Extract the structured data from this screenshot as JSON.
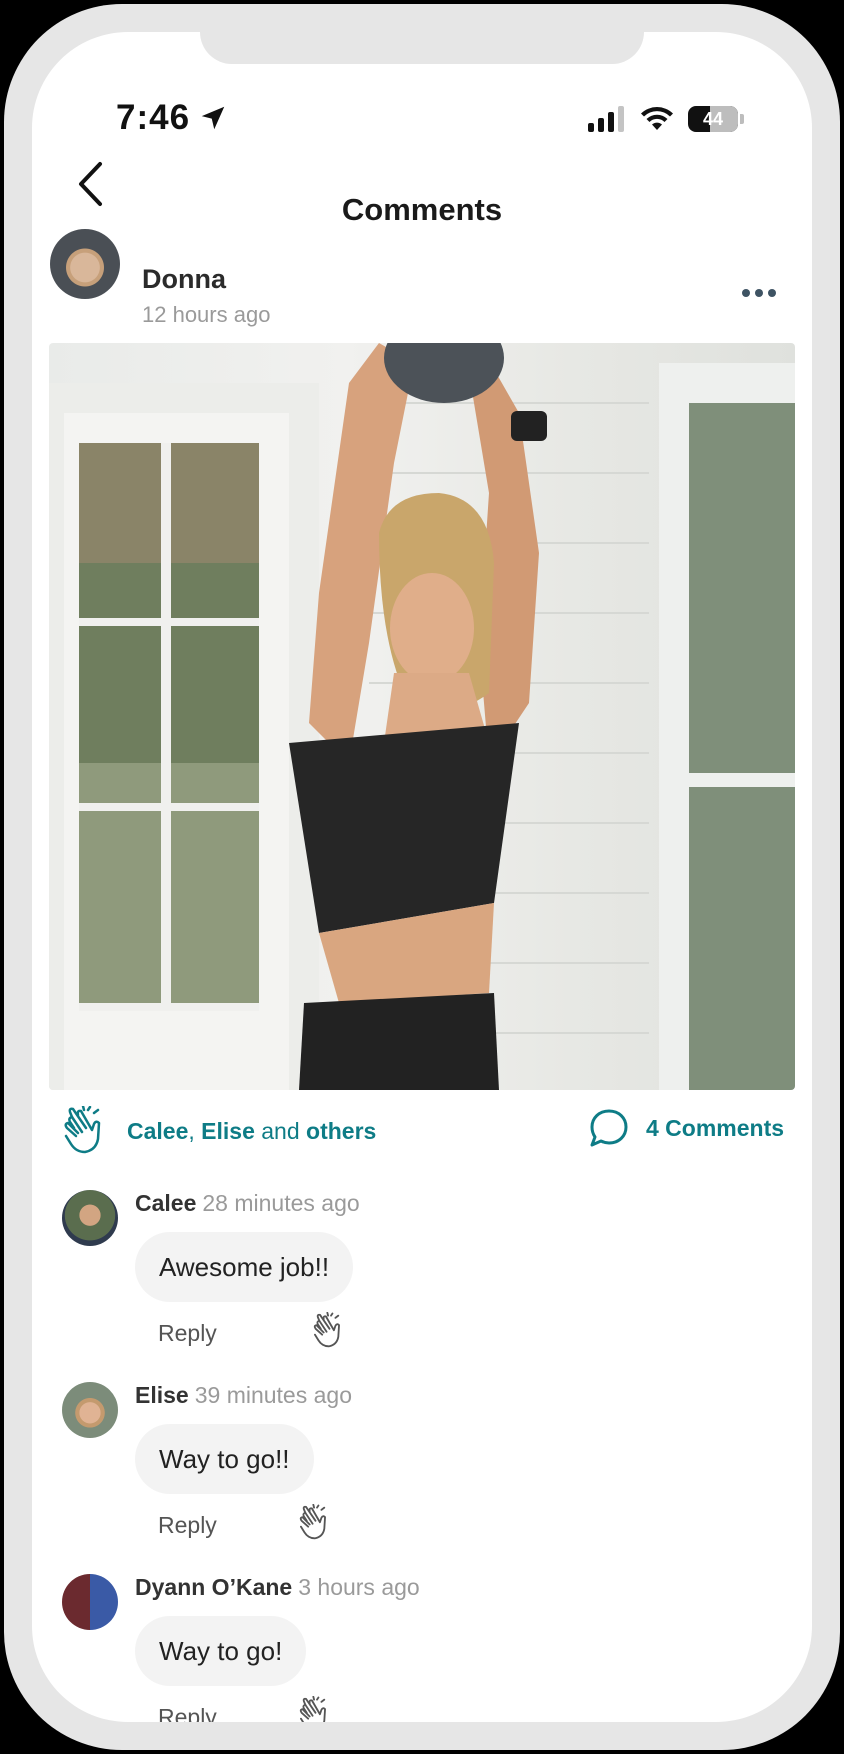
{
  "status": {
    "time": "7:46",
    "battery": "44"
  },
  "header": {
    "title": "Comments"
  },
  "post": {
    "author": "Donna",
    "time": "12 hours ago",
    "likers": {
      "name1": "Calee",
      "sep": ",",
      "name2": "Elise",
      "and": "and",
      "others": "others"
    },
    "comments_label": "4 Comments"
  },
  "comments": [
    {
      "name": "Calee",
      "time": "28 minutes ago",
      "text": "Awesome job!!",
      "reply": "Reply"
    },
    {
      "name": "Elise",
      "time": "39 minutes ago",
      "text": "Way to go!!",
      "reply": "Reply"
    },
    {
      "name": "Dyann O’Kane",
      "time": "3 hours ago",
      "text": "Way to go!",
      "reply": "Reply"
    }
  ],
  "colors": {
    "accent": "#0e7c86",
    "bubble": "#f3f3f3"
  },
  "icons": [
    "back-chevron-icon",
    "location-arrow-icon",
    "signal-icon",
    "wifi-icon",
    "battery-icon",
    "more-icon",
    "clap-icon",
    "comment-bubble-icon"
  ]
}
